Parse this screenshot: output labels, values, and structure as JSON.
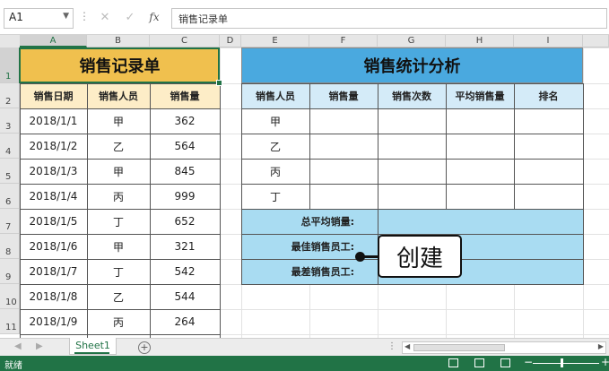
{
  "formula_bar": {
    "name_box": "A1",
    "fx_label": "fx",
    "content": "销售记录单"
  },
  "columns": [
    "A",
    "B",
    "C",
    "D",
    "E",
    "F",
    "G",
    "H",
    "I"
  ],
  "rows": [
    "1",
    "2",
    "3",
    "4",
    "5",
    "6",
    "7",
    "8",
    "9",
    "10",
    "11"
  ],
  "sales_record": {
    "title": "销售记录单",
    "headers": [
      "销售日期",
      "销售人员",
      "销售量"
    ],
    "rows": [
      [
        "2018/1/1",
        "甲",
        "362"
      ],
      [
        "2018/1/2",
        "乙",
        "564"
      ],
      [
        "2018/1/3",
        "甲",
        "845"
      ],
      [
        "2018/1/4",
        "丙",
        "999"
      ],
      [
        "2018/1/5",
        "丁",
        "652"
      ],
      [
        "2018/1/6",
        "甲",
        "321"
      ],
      [
        "2018/1/7",
        "丁",
        "542"
      ],
      [
        "2018/1/8",
        "乙",
        "544"
      ],
      [
        "2018/1/9",
        "丙",
        "264"
      ]
    ]
  },
  "sales_stats": {
    "title": "销售统计分析",
    "headers": [
      "销售人员",
      "销售量",
      "销售次数",
      "平均销售量",
      "排名"
    ],
    "people": [
      "甲",
      "乙",
      "丙",
      "丁"
    ],
    "summary_labels": [
      "总平均销量:",
      "最佳销售员工:",
      "最差销售员工:"
    ]
  },
  "callout": {
    "text": "创建"
  },
  "sheet_tabs": {
    "active": "Sheet1",
    "add_label": "+"
  },
  "status_bar": {
    "ready": "就绪"
  },
  "colors": {
    "left_title": "#f0c04e",
    "left_header": "#fdedc7",
    "right_title": "#4aa9df",
    "right_header": "#d4ebf8",
    "summary": "#a9dcf2",
    "accent": "#217346"
  }
}
